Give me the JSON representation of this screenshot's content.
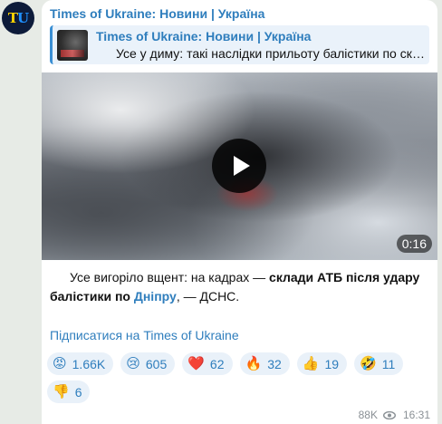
{
  "avatar": {
    "letters_t": "T",
    "letters_u": "U"
  },
  "channel_name": "Times of Ukraine: Новини | Україна",
  "reply": {
    "title": "Times of Ukraine: Новини | Україна",
    "text": "Усе у диму: такі наслідки прильоту балістики по складах АТБ у Дніпрі"
  },
  "video": {
    "duration": "0:16"
  },
  "caption": {
    "part1": "Усе вигоріло вщент: на кадрах — ",
    "bold": "склади АТБ після удару балістики по ",
    "link": "Дніпру",
    "part2": ", — ДСНС."
  },
  "subscribe_link": "Підписатися на Times of Ukraine",
  "reactions": [
    {
      "emoji": "😡",
      "icon": "angry-face-icon",
      "count": "1.66K"
    },
    {
      "emoji": "😢",
      "icon": "crying-face-icon",
      "count": "605"
    },
    {
      "emoji": "❤️",
      "icon": "heart-icon",
      "count": "62"
    },
    {
      "emoji": "🔥",
      "icon": "fire-icon",
      "count": "32"
    },
    {
      "emoji": "👍",
      "icon": "thumbs-up-icon",
      "count": "19"
    },
    {
      "emoji": "🤣",
      "icon": "laughing-face-icon",
      "count": "11"
    },
    {
      "emoji": "👎",
      "icon": "thumbs-down-icon",
      "count": "6"
    }
  ],
  "meta": {
    "views": "88K",
    "time": "16:31"
  },
  "colors": {
    "accent": "#2f7ebd",
    "background": "#e7ebe6",
    "reaction_bg": "#e9f1f9"
  }
}
